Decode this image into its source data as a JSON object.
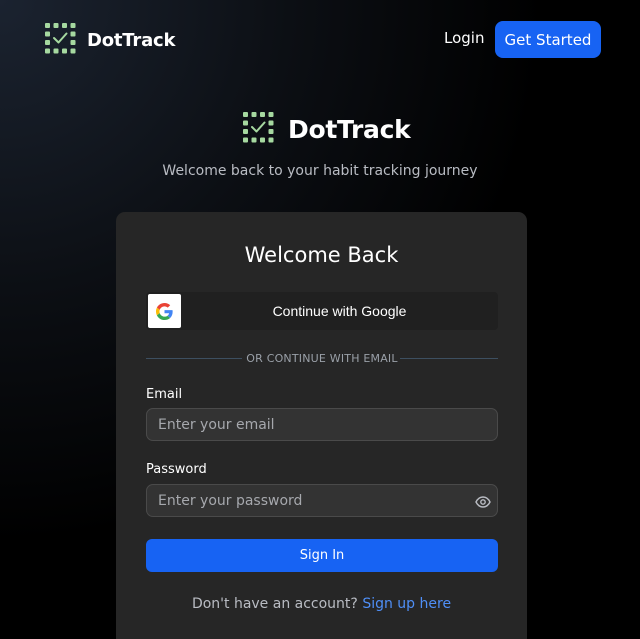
{
  "header": {
    "brand_name": "DotTrack",
    "logo_icon": "dot-grid-check-icon",
    "login_label": "Login",
    "get_started_label": "Get Started"
  },
  "hero": {
    "brand_name": "DotTrack",
    "logo_icon": "dot-grid-check-icon",
    "tagline": "Welcome back to your habit tracking journey"
  },
  "card": {
    "title": "Welcome Back",
    "google_button_label": "Continue with Google",
    "google_icon": "google-icon",
    "divider_text": "OR CONTINUE WITH EMAIL",
    "email_label": "Email",
    "email_placeholder": "Enter your email",
    "email_value": "",
    "password_label": "Password",
    "password_placeholder": "Enter your password",
    "password_value": "",
    "password_toggle_icon": "eye-icon",
    "sign_in_label": "Sign In",
    "signup_prompt": "Don't have an account?",
    "signup_link": "Sign up here"
  },
  "colors": {
    "accent": "#1763f3",
    "link": "#4f8ff7",
    "logo_dot": "#a6d9a0",
    "card_bg": "#262626"
  }
}
